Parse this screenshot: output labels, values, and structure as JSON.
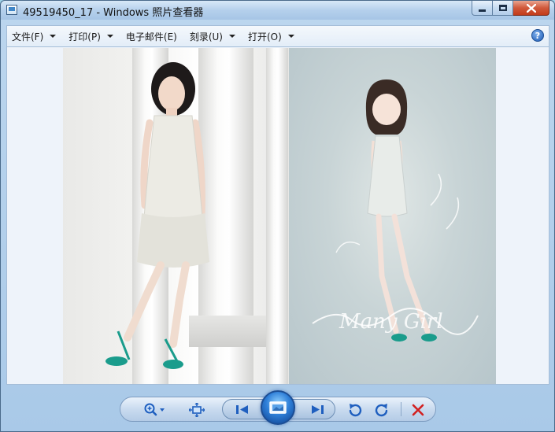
{
  "window": {
    "title": "49519450_17 - Windows 照片查看器",
    "caption_buttons": {
      "minimize_icon": "minimize-icon",
      "maximize_icon": "maximize-icon",
      "close_icon": "close-icon"
    }
  },
  "menu": {
    "items": [
      {
        "label": "文件(F)",
        "has_dropdown": true
      },
      {
        "label": "打印(P)",
        "has_dropdown": true
      },
      {
        "label": "电子邮件(E)",
        "has_dropdown": false
      },
      {
        "label": "刻录(U)",
        "has_dropdown": true
      },
      {
        "label": "打开(O)",
        "has_dropdown": true
      }
    ],
    "help_icon": "help-icon",
    "help_glyph": "?"
  },
  "viewer": {
    "image": "photo-of-woman-and-illustrated-girl",
    "illustration_caption": "Many Girl"
  },
  "controls": {
    "zoom_icon": "zoom-icon",
    "fit_icon": "actual-size-icon",
    "prev_icon": "previous-icon",
    "slideshow_icon": "slideshow-icon",
    "next_icon": "next-icon",
    "rotate_ccw_icon": "rotate-counterclockwise-icon",
    "rotate_cw_icon": "rotate-clockwise-icon",
    "delete_icon": "delete-icon"
  },
  "colors": {
    "accent": "#1d5bb5",
    "close_button": "#c23b1b",
    "delete_red": "#d22020",
    "rotate_blue": "#1f5fbf",
    "teal_shoes": "#1a9c8c"
  }
}
